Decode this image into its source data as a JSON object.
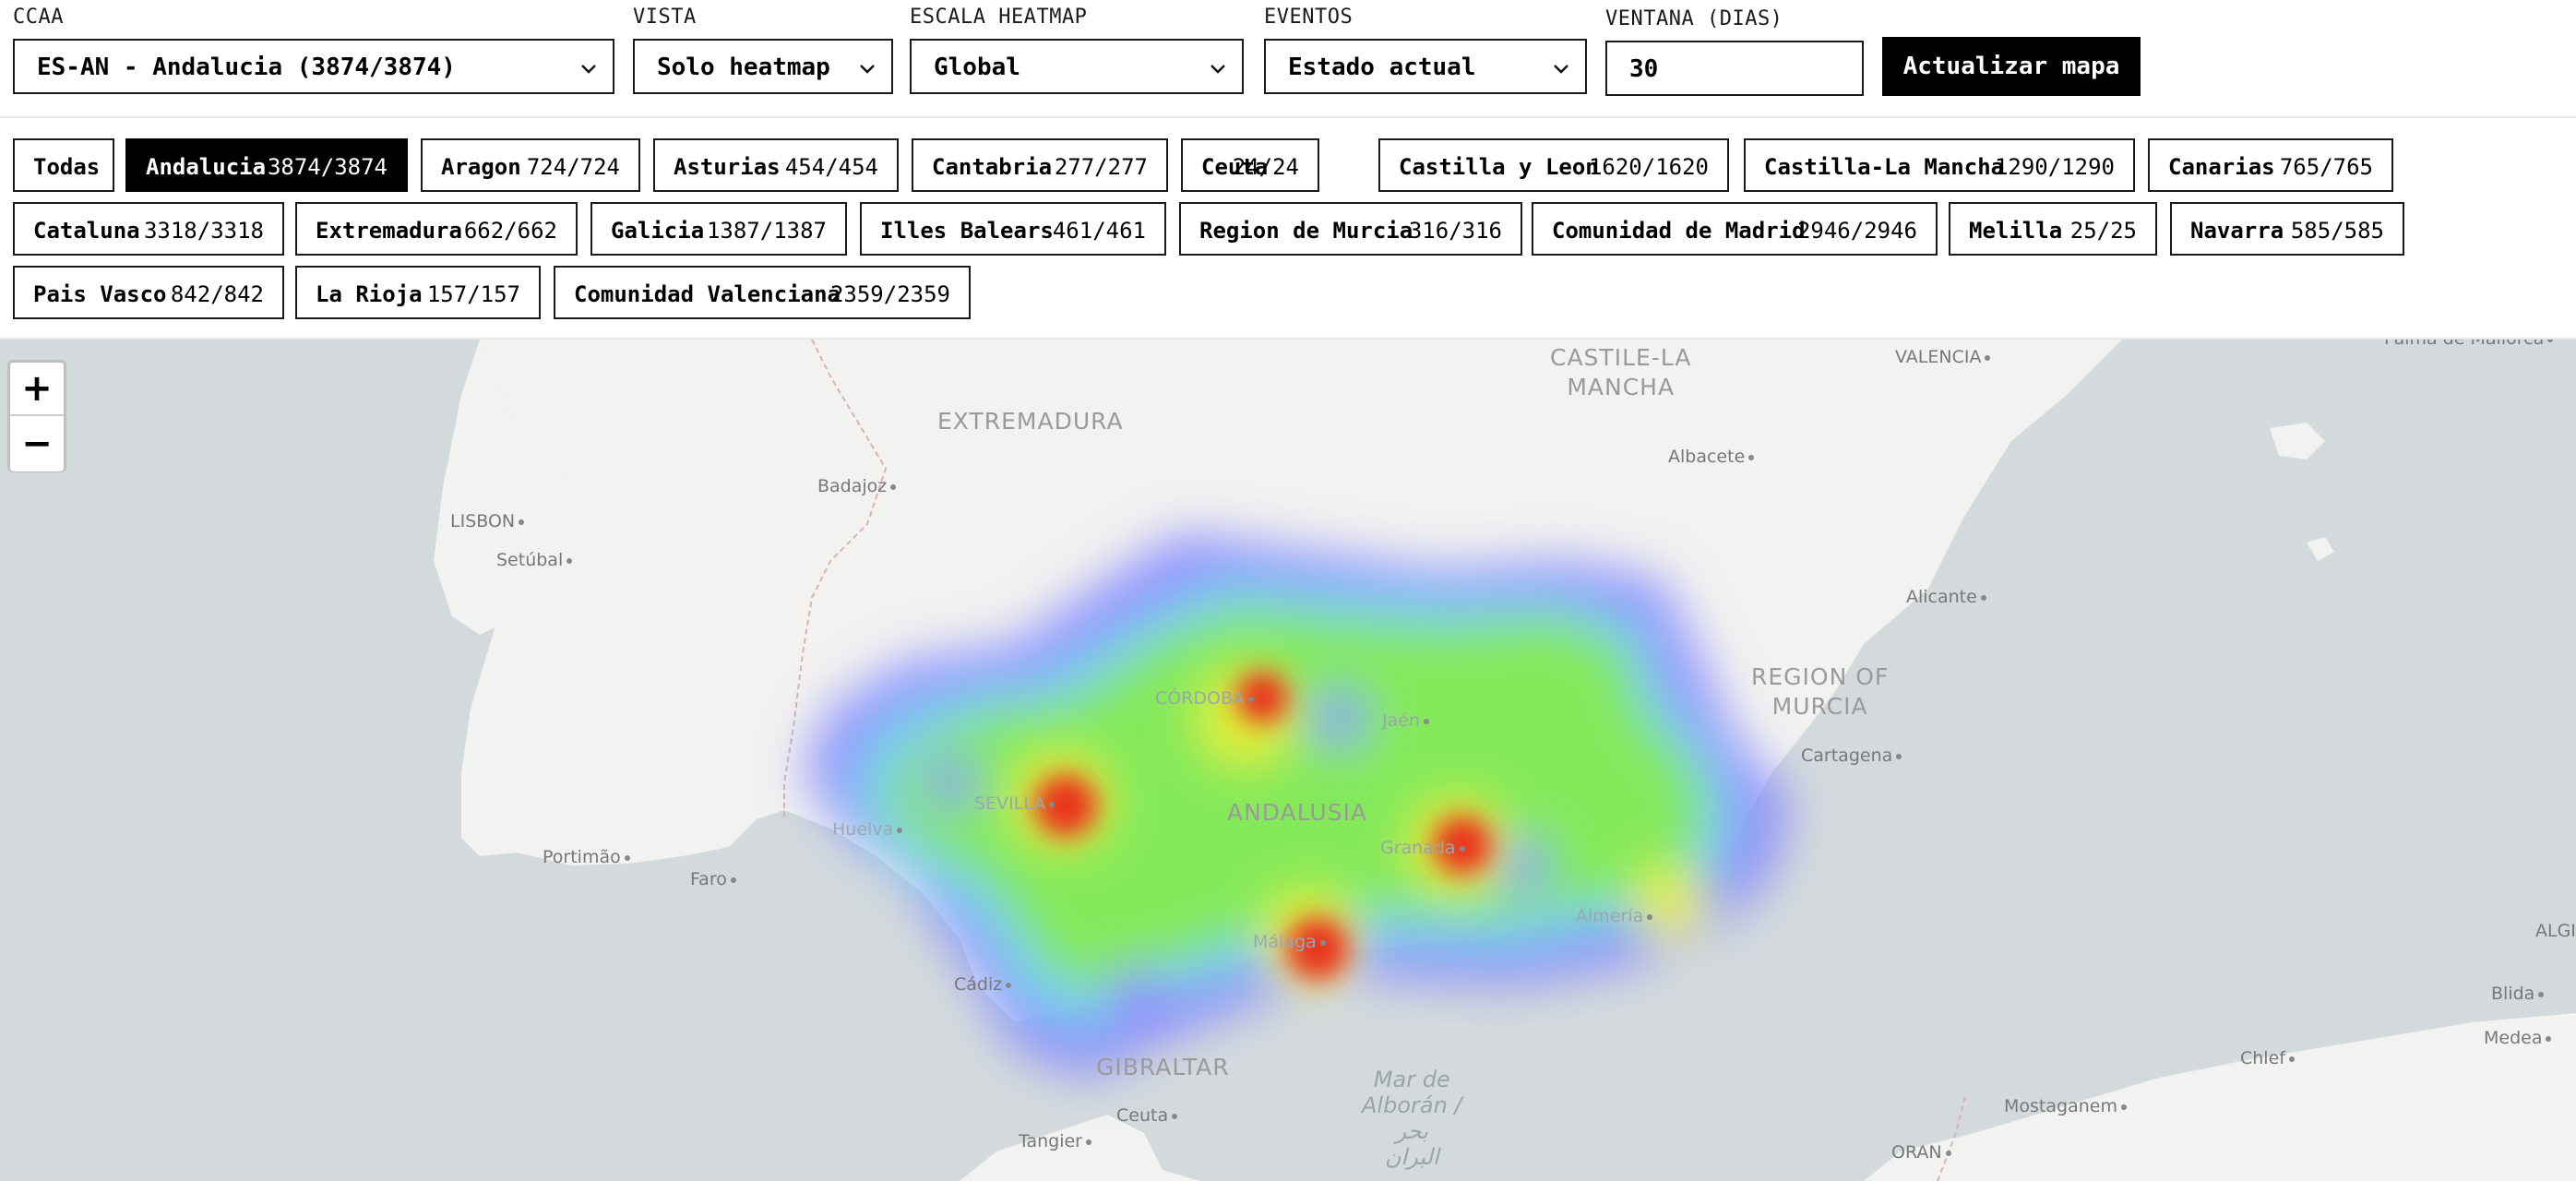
{
  "controls": {
    "ccaa": {
      "label": "CCAA",
      "value": "ES-AN - Andalucia (3874/3874)"
    },
    "vista": {
      "label": "VISTA",
      "value": "Solo heatmap"
    },
    "escala": {
      "label": "ESCALA HEATMAP",
      "value": "Global"
    },
    "eventos": {
      "label": "EVENTOS",
      "value": "Estado actual"
    },
    "ventana": {
      "label": "VENTANA (DIAS)",
      "value": "30"
    },
    "update_button": "Actualizar mapa"
  },
  "chips": [
    {
      "name": "Todas",
      "count": ""
    },
    {
      "name": "Andalucia",
      "count": "3874/3874",
      "active": true
    },
    {
      "name": "Aragon",
      "count": "724/724"
    },
    {
      "name": "Asturias",
      "count": "454/454"
    },
    {
      "name": "Cantabria",
      "count": "277/277"
    },
    {
      "name": "Ceuta",
      "count": "24/24"
    },
    {
      "name": "Castilla y Leon",
      "count": "1620/1620"
    },
    {
      "name": "Castilla-La Mancha",
      "count": "1290/1290"
    },
    {
      "name": "Canarias",
      "count": "765/765"
    },
    {
      "name": "Cataluna",
      "count": "3318/3318"
    },
    {
      "name": "Extremadura",
      "count": "662/662"
    },
    {
      "name": "Galicia",
      "count": "1387/1387"
    },
    {
      "name": "Illes Balears",
      "count": "461/461"
    },
    {
      "name": "Region de Murcia",
      "count": "316/316"
    },
    {
      "name": "Comunidad de Madrid",
      "count": "2946/2946"
    },
    {
      "name": "Melilla",
      "count": "25/25"
    },
    {
      "name": "Navarra",
      "count": "585/585"
    },
    {
      "name": "Pais Vasco",
      "count": "842/842"
    },
    {
      "name": "La Rioja",
      "count": "157/157"
    },
    {
      "name": "Comunidad Valenciana",
      "count": "2359/2359"
    }
  ],
  "map": {
    "zoom_in": "+",
    "zoom_out": "−",
    "regions": {
      "castile_la_mancha": "CASTILE-LA\nMANCHA",
      "extremadura": "EXTREMADURA",
      "andalusia": "ANDALUSIA",
      "region_of_murcia": "REGION OF\nMURCIA",
      "gibraltar": "GIBRALTAR"
    },
    "cities": {
      "valencia": "VALENCIA",
      "palma": "Palma de Mallorca",
      "albacete": "Albacete",
      "badajoz": "Badajoz",
      "lisbon": "LISBON",
      "setubal": "Setúbal",
      "alicante": "Alicante",
      "cordoba": "CÓRDOBA",
      "jaen": "Jaén",
      "cartagena": "Cartagena",
      "sevilla": "SEVILLA",
      "huelva": "Huelva",
      "granada": "Granada",
      "portimao": "Portimão",
      "faro": "Faro",
      "almeria": "Almería",
      "malaga": "Málaga",
      "cadiz": "Cádiz",
      "algiers": "ALGIERS",
      "blida": "Blida",
      "medea": "Medea",
      "chlef": "Chlef",
      "mostaganem": "Mostaganem",
      "oran": "ORAN",
      "ceuta": "Ceuta",
      "tangier": "Tangier"
    },
    "sea": "Mar de\nAlborán /\nبحر\nالبران",
    "colors": {
      "sea": "#d4dadc",
      "land": "#f2f2f0",
      "heat_red": "#e8301c",
      "heat_green": "#7fe84a",
      "heat_blue": "#7a7aff"
    }
  }
}
